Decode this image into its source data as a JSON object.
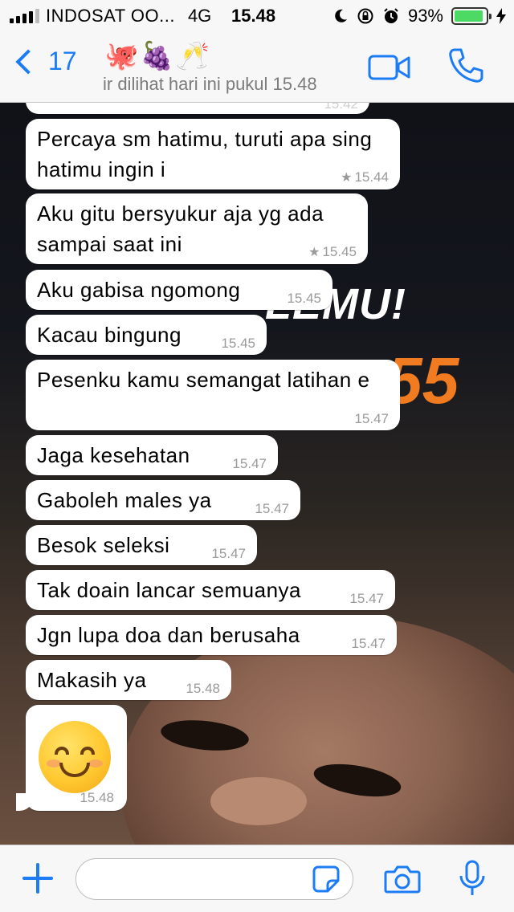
{
  "status_bar": {
    "carrier": "INDOSAT OO...",
    "network": "4G",
    "time": "15.48",
    "battery_percent": "93%",
    "battery_level": 0.93,
    "icons": [
      "moon-icon",
      "rotation-lock-icon",
      "alarm-icon",
      "charging-bolt-icon"
    ]
  },
  "nav": {
    "back_count": "17",
    "contact_name": "🐙🍇🥂",
    "last_seen": "ir dilihat hari ini pukul 15.48",
    "icons": [
      "video-call-icon",
      "phone-call-icon"
    ]
  },
  "wallpaper": {
    "text": "LEMU!",
    "number": "55"
  },
  "messages": [
    {
      "text": "",
      "time": "15.42",
      "starred": false
    },
    {
      "text": "Percaya sm hatimu, turuti  apa sing hatimu ingin i",
      "time": "15.44",
      "starred": true
    },
    {
      "text": "Aku gitu bersyukur aja yg ada sampai saat ini",
      "time": "15.45",
      "starred": true
    },
    {
      "text": "Aku gabisa ngomong",
      "time": "15.45",
      "starred": false
    },
    {
      "text": "Kacau bingung",
      "time": "15.45",
      "starred": false
    },
    {
      "text": "Pesenku kamu semangat latihan e",
      "time": "15.47",
      "starred": false
    },
    {
      "text": "Jaga kesehatan",
      "time": "15.47",
      "starred": false
    },
    {
      "text": "Gaboleh males ya",
      "time": "15.47",
      "starred": false
    },
    {
      "text": "Besok seleksi",
      "time": "15.47",
      "starred": false
    },
    {
      "text": "Tak doain lancar semuanya",
      "time": "15.47",
      "starred": false
    },
    {
      "text": "Jgn lupa doa dan berusaha",
      "time": "15.47",
      "starred": false
    },
    {
      "text": "Makasih ya",
      "time": "15.48",
      "starred": false
    },
    {
      "emoji": "smiling-face-emoji",
      "time": "15.48",
      "starred": false
    }
  ],
  "input_bar": {
    "placeholder": "",
    "icons": [
      "plus-icon",
      "sticker-icon",
      "camera-icon",
      "microphone-icon"
    ]
  },
  "colors": {
    "accent": "#1b7cf5",
    "bubble": "#ffffff",
    "battery": "#4cd964",
    "wallpaper_number": "#f07b20"
  }
}
